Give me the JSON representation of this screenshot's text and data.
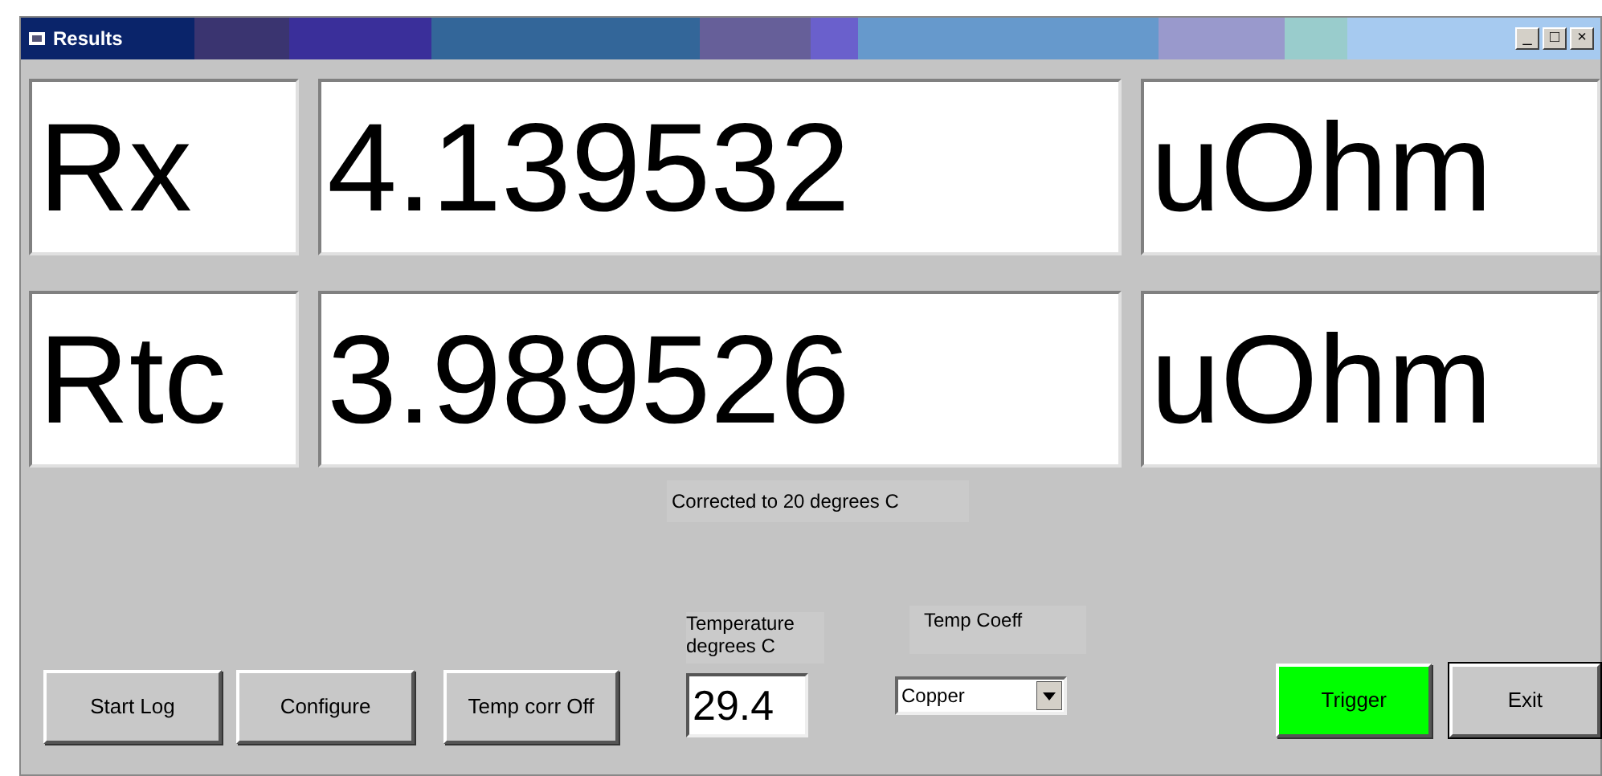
{
  "window": {
    "title": "Results"
  },
  "title_buttons": [
    "_",
    "□",
    "×"
  ],
  "readouts": [
    {
      "label": "Rx",
      "value": "4.139532",
      "unit": "uOhm"
    },
    {
      "label": "Rtc",
      "value": "3.989526",
      "unit": "uOhm"
    }
  ],
  "note": "Corrected to 20 degrees C",
  "buttons": [
    {
      "label": "Start Log"
    },
    {
      "label": "Configure"
    },
    {
      "label": "Temp corr Off"
    }
  ],
  "temperature": {
    "label": "Temperature degrees C",
    "value": "29.4"
  },
  "temp_coeff": {
    "label": "Temp Coeff",
    "value": "Copper"
  },
  "trigger": {
    "label": "Trigger",
    "on": true
  },
  "exit": {
    "label": "Exit"
  }
}
